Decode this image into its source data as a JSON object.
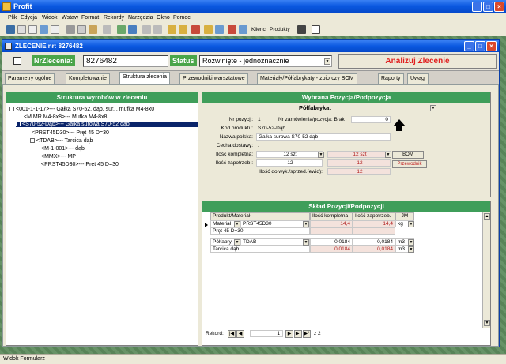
{
  "app": {
    "title": "Profit"
  },
  "menu": [
    "Plik",
    "Edycja",
    "Widok",
    "Wstaw",
    "Format",
    "Rekordy",
    "Narzędzia",
    "Okno",
    "Pomoc"
  ],
  "toolbar": {
    "klienci": "Klienci",
    "produkty": "Produkty"
  },
  "window": {
    "title": "ZLECENIE nr: 8276482"
  },
  "header": {
    "nr_label": "NrZlecenia:",
    "nr_value": "8276482",
    "status_label": "Status",
    "status_value": "Rozwinięte - jednoznacznie",
    "analyze_label": "Analizuj Zlecenie"
  },
  "tabs": [
    "Parametry ogólne",
    "Kompletowanie",
    "Struktura zlecenia",
    "Przewodniki warsztatowe",
    "Materiały/Półfabrykaty - zbiorczy BOM",
    "Raporty",
    "Uwagi"
  ],
  "tree": {
    "title": "Struktura wyrobów w zleceniu",
    "items": [
      "<001-1-1-17>--- Gałka S70-52, dąb, sur. , mufka M4-8x0",
      "<M.MR M4-8x8>--- Mufka M4-8x8",
      "<S70-52-Dąb>--- Gałka surowa S70-52 dąb",
      "<PRST45D30>--- Pręt 45 D=30",
      "<TDAB>--- Tarcica dąb",
      "<M-1-001>--- dąb",
      "<MMX>--- MP",
      "<PRST45D30>--- Pręt 45 D=30"
    ]
  },
  "selected": {
    "title": "Wybrana Pozycja/Podpozycja",
    "type": "Półfabrykat",
    "nr_pozycji_label": "Nr pozycji:",
    "nr_pozycji": "1",
    "nr_zam_label": "Nr zamówienia/pozycja: Brak",
    "nr_zam_value": "0",
    "kod_label": "Kod produktu:",
    "kod": "S70-52-Dąb",
    "nazwa_label": "Nazwa polska:",
    "nazwa": "Gałka surowa S70-52 dąb",
    "cecha_label": "Cecha dostawy:",
    "cecha": ".",
    "ilosc_k_label": "Ilość kompletna:",
    "ilosc_k": "12 szt",
    "ilosc_k2": "12 szt",
    "ilosc_z_label": "Ilość zapotrzeb.:",
    "ilosc_z": "12",
    "ilosc_z2": "12",
    "ilosc_w_label": "Ilość do wyk./sprzed.(ewid):",
    "ilosc_w": "12",
    "bom_btn": "BOM",
    "przewodnik_btn": "Przewodnik"
  },
  "sklad": {
    "title": "Skład Pozycji/Podpozycji",
    "columns": [
      "Produkt/Materiał",
      "Ilość kompletna",
      "Ilość zapotrzeb.",
      "JM"
    ],
    "rows": [
      {
        "type": "Materiał",
        "code": "PRST45D30",
        "name": "Pręt 45 D=30",
        "k": "14,4",
        "z": "14,4",
        "jm": "kg"
      },
      {
        "type": "Półfabry",
        "code": "TDAB",
        "name": "Tarcica dąb",
        "k": "0,0184",
        "z": "0,0184",
        "jm": "m3"
      }
    ],
    "rekord_label": "Rekord:",
    "rekord_value": "1",
    "rekord_of": "z 2"
  },
  "status": {
    "text": "Widok Formularz"
  }
}
